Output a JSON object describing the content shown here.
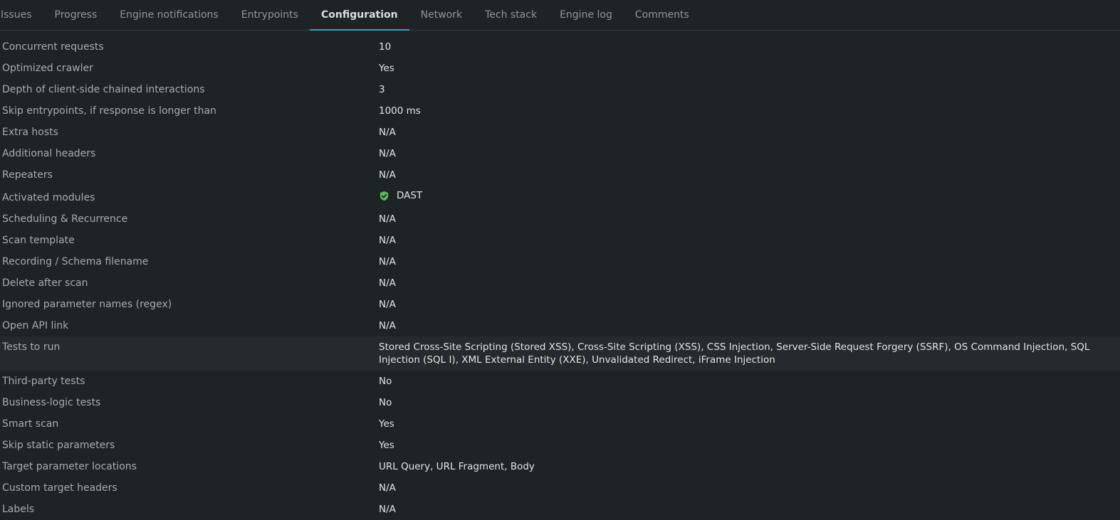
{
  "tabs": [
    {
      "label": "Issues",
      "active": false
    },
    {
      "label": "Progress",
      "active": false
    },
    {
      "label": "Engine notifications",
      "active": false
    },
    {
      "label": "Entrypoints",
      "active": false
    },
    {
      "label": "Configuration",
      "active": true
    },
    {
      "label": "Network",
      "active": false
    },
    {
      "label": "Tech stack",
      "active": false
    },
    {
      "label": "Engine log",
      "active": false
    },
    {
      "label": "Comments",
      "active": false
    }
  ],
  "config": {
    "concurrent_requests": {
      "label": "Concurrent requests",
      "value": "10"
    },
    "optimized_crawler": {
      "label": "Optimized crawler",
      "value": "Yes"
    },
    "depth_chained": {
      "label": "Depth of client-side chained interactions",
      "value": "3"
    },
    "skip_entrypoints": {
      "label": "Skip entrypoints, if response is longer than",
      "value": "1000 ms"
    },
    "extra_hosts": {
      "label": "Extra hosts",
      "value": "N/A"
    },
    "additional_headers": {
      "label": "Additional headers",
      "value": "N/A"
    },
    "repeaters": {
      "label": "Repeaters",
      "value": "N/A"
    },
    "activated_modules": {
      "label": "Activated modules",
      "value": "DAST",
      "icon": "shield-check-icon",
      "icon_color": "#5cb85c"
    },
    "scheduling": {
      "label": "Scheduling & Recurrence",
      "value": "N/A"
    },
    "scan_template": {
      "label": "Scan template",
      "value": "N/A"
    },
    "recording_schema": {
      "label": "Recording / Schema filename",
      "value": "N/A"
    },
    "delete_after_scan": {
      "label": "Delete after scan",
      "value": "N/A"
    },
    "ignored_params": {
      "label": "Ignored parameter names (regex)",
      "value": "N/A"
    },
    "open_api_link": {
      "label": "Open API link",
      "value": "N/A"
    },
    "tests_to_run": {
      "label": "Tests to run",
      "value": "Stored Cross-Site Scripting (Stored XSS), Cross-Site Scripting (XSS), CSS Injection, Server-Side Request Forgery (SSRF), OS Command Injection, SQL Injection (SQL I), XML External Entity (XXE), Unvalidated Redirect, iFrame Injection"
    },
    "third_party_tests": {
      "label": "Third-party tests",
      "value": "No"
    },
    "business_logic_tests": {
      "label": "Business-logic tests",
      "value": "No"
    },
    "smart_scan": {
      "label": "Smart scan",
      "value": "Yes"
    },
    "skip_static_params": {
      "label": "Skip static parameters",
      "value": "Yes"
    },
    "target_param_locations": {
      "label": "Target parameter locations",
      "value": "URL Query, URL Fragment, Body"
    },
    "custom_target_headers": {
      "label": "Custom target headers",
      "value": "N/A"
    },
    "labels": {
      "label": "Labels",
      "value": "N/A"
    }
  },
  "colors": {
    "background": "#1e2326",
    "accent": "#3aa4ad",
    "highlight_row": "#242a2d"
  }
}
